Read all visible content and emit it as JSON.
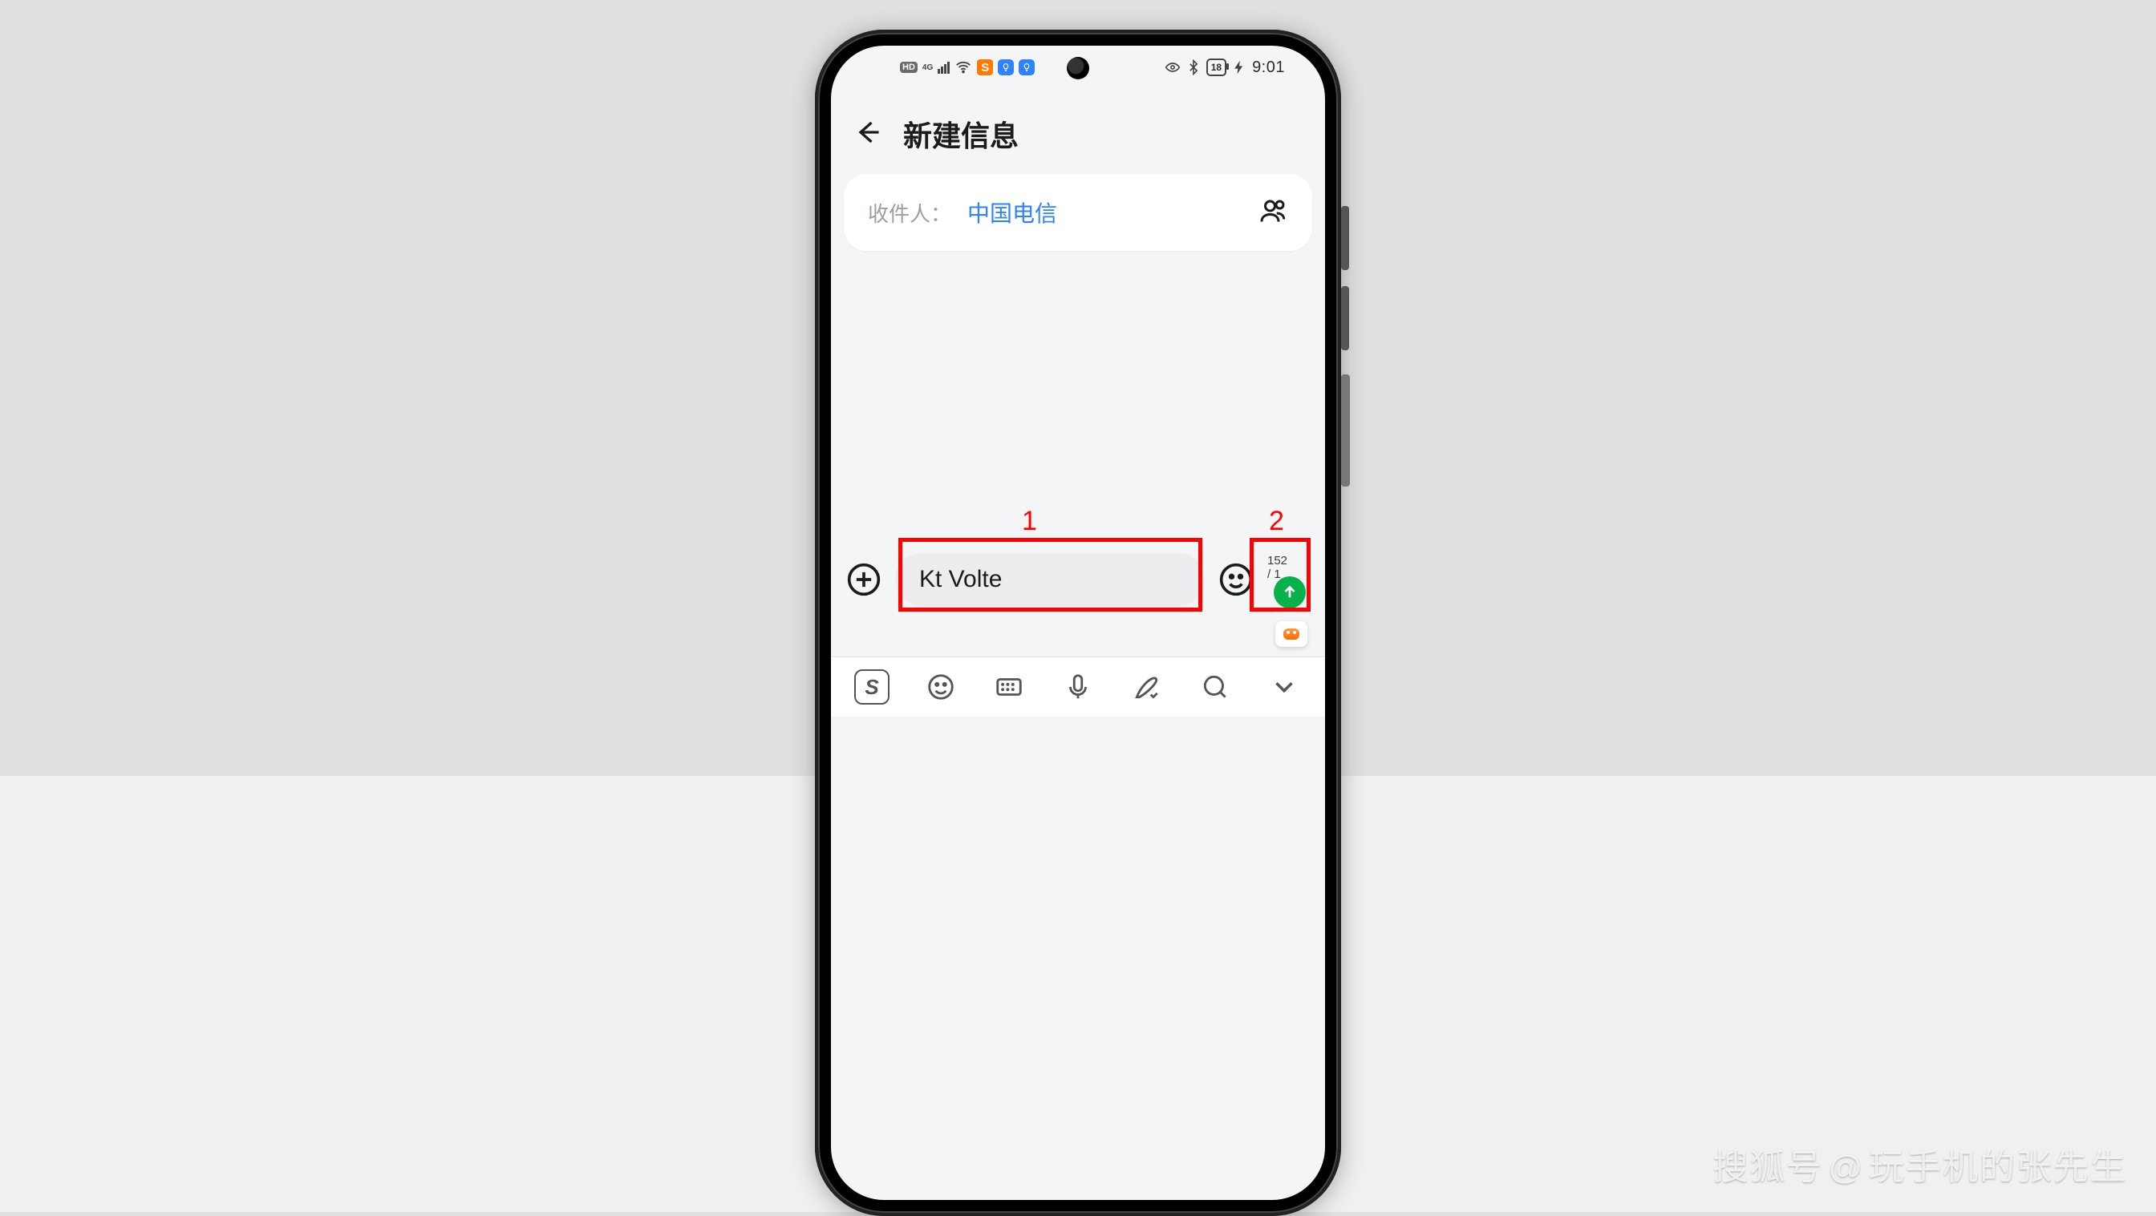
{
  "statusbar": {
    "hd": "HD",
    "net": "4G",
    "s_badge": "S",
    "battery_pct": "18",
    "time": "9:01"
  },
  "header": {
    "title": "新建信息"
  },
  "recipient": {
    "label": "收件人：",
    "value": "中国电信"
  },
  "compose": {
    "message": "Kt Volte",
    "char_count": "152 / 1"
  },
  "annotations": {
    "input_label": "1",
    "send_label": "2"
  },
  "watermark": {
    "site": "搜狐号",
    "sep": "@",
    "author": "玩手机的张先生"
  }
}
